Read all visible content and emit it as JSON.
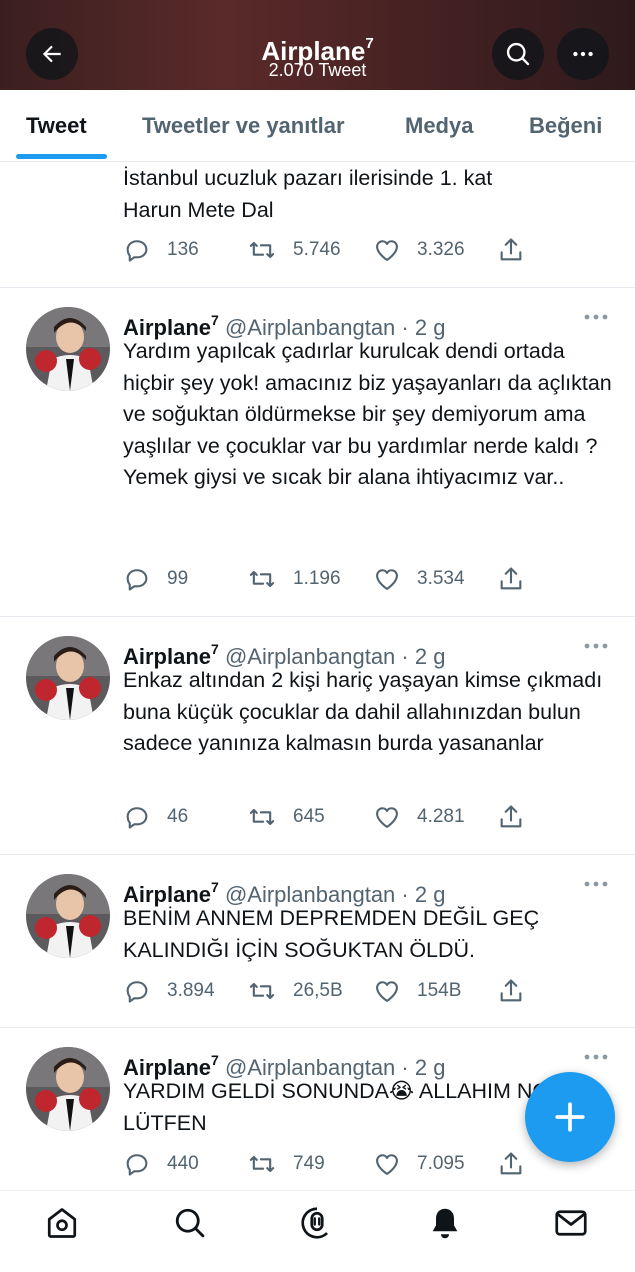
{
  "header": {
    "title": "Airplane",
    "title_sup": "7",
    "subtitle": "2.070 Tweet"
  },
  "tabs": [
    {
      "label": "Tweet",
      "active": true
    },
    {
      "label": "Tweetler ve yanıtlar",
      "active": false
    },
    {
      "label": "Medya",
      "active": false
    },
    {
      "label": "Beğeni",
      "active": false
    }
  ],
  "partial_tweet": {
    "text": "İstanbul ucuzluk pazarı ilerisinde 1. kat\nHarun Mete Dal",
    "replies": "136",
    "retweets": "5.746",
    "likes": "3.326"
  },
  "tweets": [
    {
      "name": "Airplane",
      "name_sup": "7",
      "handle": "@Airplanbangtan · 2 g",
      "text": "Yardım yapılcak çadırlar kurulcak dendi ortada hiçbir şey yok! amacınız biz yaşayanları da açlıktan ve soğuktan öldürmekse bir şey demiyorum ama yaşlılar ve çocuklar var bu yardımlar nerde kaldı ? Yemek giysi ve sıcak bir alana ihtiyacımız var..",
      "replies": "99",
      "retweets": "1.196",
      "likes": "3.534"
    },
    {
      "name": "Airplane",
      "name_sup": "7",
      "handle": "@Airplanbangtan · 2 g",
      "text": "Enkaz altından 2 kişi hariç yaşayan kimse çıkmadı buna küçük çocuklar da dahil allahınızdan bulun sadece yanınıza kalmasın burda yasananlar",
      "replies": "46",
      "retweets": "645",
      "likes": "4.281"
    },
    {
      "name": "Airplane",
      "name_sup": "7",
      "handle": "@Airplanbangtan · 2 g",
      "text": "BENİM ANNEM DEPREMDEN DEĞİL GEÇ KALINDIĞI İÇİN SOĞUKTAN ÖLDÜ.",
      "replies": "3.894",
      "retweets": "26,5B",
      "likes": "154B"
    },
    {
      "name": "Airplane",
      "name_sup": "7",
      "handle": "@Airplanbangtan · 2 g",
      "text": "YARDIM GELDİ SONUNDA😭 ALLAHIM NOLUR LÜTFEN",
      "replies": "440",
      "retweets": "749",
      "likes": "7.095"
    }
  ],
  "icons": {
    "back": "back-arrow-icon",
    "search": "search-icon",
    "more": "more-icon",
    "reply": "reply-icon",
    "retweet": "retweet-icon",
    "like": "heart-icon",
    "share": "share-icon",
    "compose": "plus-icon",
    "nav": [
      "home-icon",
      "explore-icon",
      "spaces-icon",
      "notifications-icon",
      "messages-icon"
    ]
  },
  "colors": {
    "accent": "#1d9bf0",
    "text": "#0f1419",
    "secondary": "#536471"
  }
}
